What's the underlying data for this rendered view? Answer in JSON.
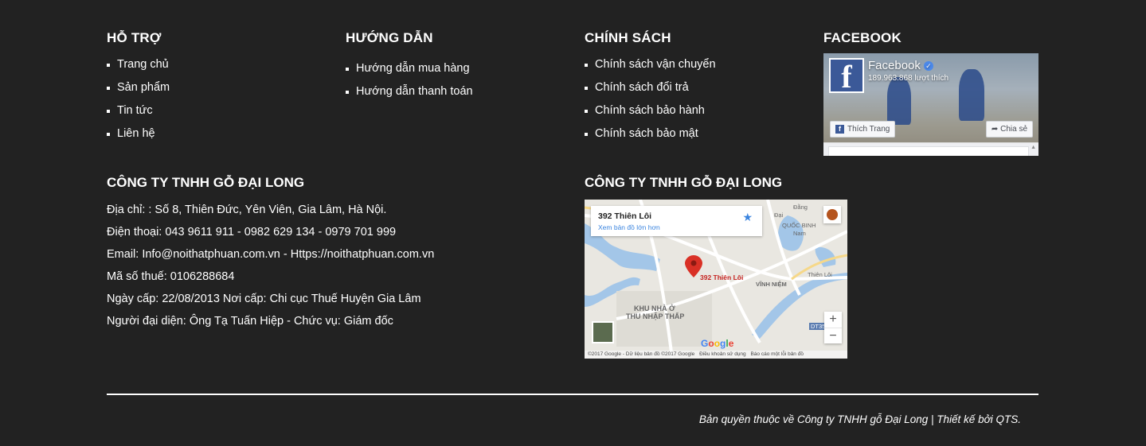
{
  "columns": [
    {
      "title": "HỖ TRỢ",
      "items": [
        "Trang chủ",
        "Sản phẩm",
        "Tin tức",
        "Liên hệ"
      ]
    },
    {
      "title": "HƯỚNG DẪN",
      "items": [
        "Hướng dẫn mua hàng",
        "Hướng dẫn thanh toán"
      ]
    },
    {
      "title": "CHÍNH SÁCH",
      "items": [
        "Chính sách vận chuyển",
        "Chính sách đổi trả",
        "Chính sách bảo hành",
        "Chính sách bảo mật"
      ]
    },
    {
      "title": "FACEBOOK"
    }
  ],
  "facebook": {
    "page_name": "Facebook",
    "likes": "189.963.868 lượt thích",
    "like_button": "Thích Trang",
    "share_button": "Chia sẻ",
    "logo_letter": "f"
  },
  "company": {
    "title": "CÔNG TY TNHH GỖ ĐẠI LONG",
    "lines": [
      "Địa chỉ: : Số 8, Thiên Đức, Yên Viên, Gia Lâm, Hà Nội.",
      "Điện thoại: 043 9611 911 - 0982 629 134 - 0979 701 999",
      "Email: Info@noithatphuan.com.vn - Https://noithatphuan.com.vn",
      "Mã số thuế: 0106288684",
      "Ngày cấp: 22/08/2013 Nơi cấp: Chi cục Thuế Huyện Gia Lâm",
      "Người đại diện: Ông Tạ Tuấn Hiệp - Chức vụ: Giám đốc"
    ]
  },
  "map_section": {
    "title": "CÔNG TY TNHH GỖ ĐẠI LONG",
    "place_name": "392 Thiên Lôi",
    "larger_map_link": "Xem bản đồ lớn hơn",
    "pin_label": "392 Thiên Lôi",
    "labels": {
      "khu": "KHU NHÀ Ở",
      "thu": "THU NHẬP THẤP",
      "vinh": "VĨNH NIỆM",
      "thienloi": "Thiên Lôi",
      "dang": "Đằng",
      "quocbinh": "QUỐC BINH",
      "nam": "Nam",
      "dt": "DT35",
      "dai": "Đại"
    },
    "zoom_in": "+",
    "zoom_out": "−",
    "google": "Google",
    "footer": [
      "©2017 Google - Dữ liệu bản đồ ©2017 Google",
      "Điều khoản sử dụng",
      "Báo cáo một lỗi bản đồ"
    ],
    "accent_color": "#3a84df",
    "pin_color": "#d93025"
  },
  "footer": {
    "copyright": "Bản quyền thuộc về Công ty TNHH gỗ Đại Long | Thiết kế bởi QTS."
  }
}
